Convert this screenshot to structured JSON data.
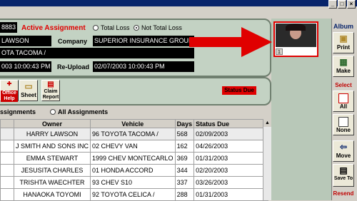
{
  "assignment": {
    "id_partial": "8883",
    "active_label": "Active Assignment",
    "loss_options": [
      "Total Loss",
      "Not Total Loss"
    ],
    "selected_loss": "Not Total Loss",
    "owner_name": "LAWSON",
    "company_label": "Company",
    "company_value": "SUPERIOR INSURANCE GROUPS",
    "vehicle_value": "OTA TACOMA /",
    "upload_date": "003 10:00:43 PM",
    "reupload_label": "Re-Upload",
    "reupload_date": "02/07/2003 10:00:43 PM",
    "status_due_badge": "Status Due"
  },
  "toolbar": {
    "buttons": [
      {
        "label": "Office Help"
      },
      {
        "label": "Sheet"
      },
      {
        "label": "Claim Report"
      }
    ]
  },
  "filter": {
    "partial_label": "ssignments",
    "all_label": "All Assignments"
  },
  "table": {
    "headers": [
      "Owner",
      "Vehicle",
      "Days",
      "Status Due"
    ],
    "rows": [
      {
        "owner": "HARRY LAWSON",
        "vehicle": "96 TOYOTA TACOMA /",
        "days": "568",
        "status_due": "02/09/2003"
      },
      {
        "owner": "J SMITH AND SONS INC",
        "vehicle": "02 CHEVY VAN",
        "days": "162",
        "status_due": "04/26/2003"
      },
      {
        "owner": "EMMA STEWART",
        "vehicle": "1999 CHEV MONTECARLO",
        "days": "369",
        "status_due": "01/31/2003"
      },
      {
        "owner": "JESUSITA CHARLES",
        "vehicle": "01 HONDA ACCORD",
        "days": "344",
        "status_due": "02/20/2003"
      },
      {
        "owner": "TRISHTA WAECHTER",
        "vehicle": "93 CHEV S10",
        "days": "337",
        "status_due": "03/26/2003"
      },
      {
        "owner": "HANAOKA TOYOMI",
        "vehicle": "92 TOYOTA CELICA /",
        "days": "288",
        "status_due": "01/31/2003"
      }
    ]
  },
  "album": {
    "title": "Album",
    "thumb_number": "1",
    "buttons": {
      "print": "Print",
      "make": "Make",
      "select_header": "Select",
      "all": "All",
      "none": "None",
      "move": "Move",
      "save_to": "Save To",
      "resend_header": "Resend"
    }
  },
  "colors": {
    "accent_red": "#e00000",
    "panel_green": "#c3d2c3",
    "titlebar_blue": "#08246b"
  }
}
